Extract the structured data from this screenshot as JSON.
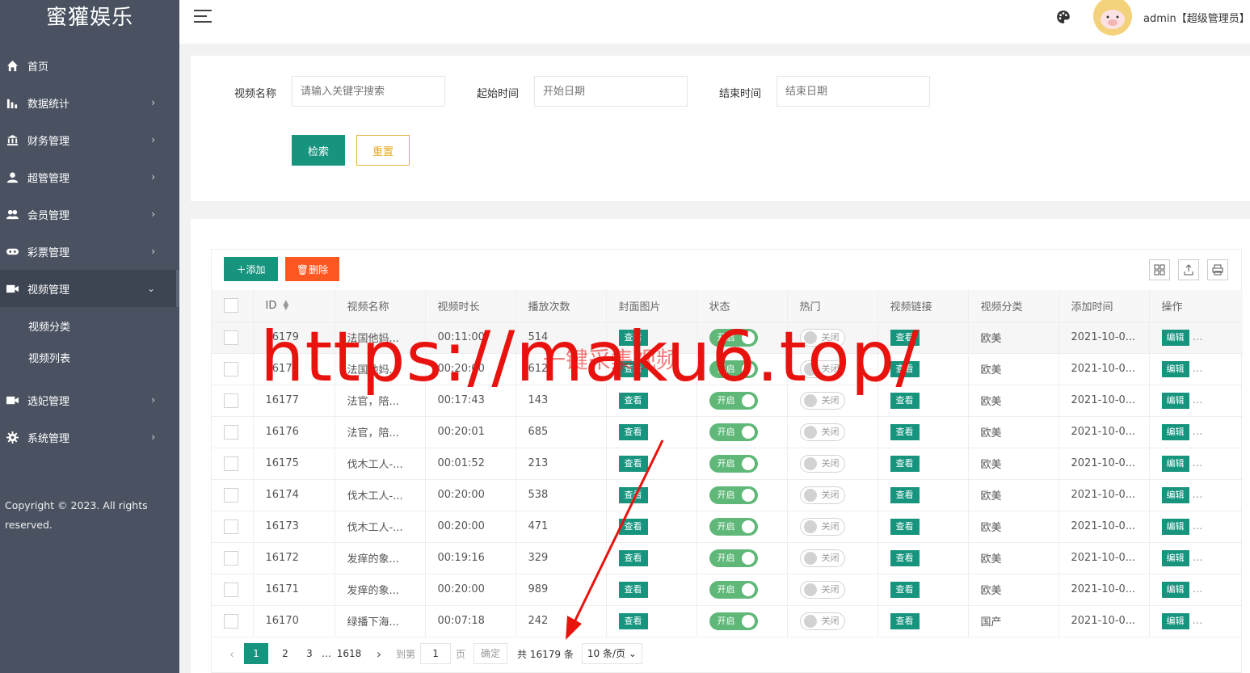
{
  "app": {
    "logo": "蜜獾娱乐"
  },
  "sidebar": {
    "items": [
      {
        "label": "首页",
        "icon": "home-icon",
        "arrow": ""
      },
      {
        "label": "数据统计",
        "icon": "bar-chart-icon",
        "arrow": "›"
      },
      {
        "label": "财务管理",
        "icon": "bank-icon",
        "arrow": "›"
      },
      {
        "label": "超管管理",
        "icon": "user-icon",
        "arrow": "›"
      },
      {
        "label": "会员管理",
        "icon": "users-icon",
        "arrow": "›"
      },
      {
        "label": "彩票管理",
        "icon": "gamepad-icon",
        "arrow": "›"
      },
      {
        "label": "视频管理",
        "icon": "video-icon",
        "arrow": "⌄"
      }
    ],
    "sub_items": [
      {
        "label": "视频分类"
      },
      {
        "label": "视频列表"
      }
    ],
    "items_after": [
      {
        "label": "选妃管理",
        "icon": "video-icon",
        "arrow": "›"
      },
      {
        "label": "系统管理",
        "icon": "gear-icon",
        "arrow": "›"
      }
    ],
    "copyright": "Copyright © 2023. All rights reserved."
  },
  "header": {
    "user": "admin【超级管理员】"
  },
  "search": {
    "name_label": "视频名称",
    "name_placeholder": "请输入关键字搜索",
    "start_label": "起始时间",
    "start_placeholder": "开始日期",
    "end_label": "结束时间",
    "end_placeholder": "结束日期",
    "search_btn": "检索",
    "reset_btn": "重置"
  },
  "toolbar": {
    "add_label": "添加",
    "delete_label": "删除"
  },
  "table": {
    "columns": [
      "ID",
      "视频名称",
      "视频时长",
      "播放次数",
      "封面图片",
      "状态",
      "热门",
      "视频链接",
      "视频分类",
      "添加时间",
      "操作"
    ],
    "view_label": "查看",
    "on_label": "开启",
    "off_label": "关闭",
    "edit_label": "编辑",
    "more_label": "…",
    "rows": [
      {
        "id": "16179",
        "name": "法国他妈...",
        "duration": "00:11:00",
        "plays": "514",
        "category": "欧美",
        "added": "2021-10-0..."
      },
      {
        "id": "16178",
        "name": "法国他妈...",
        "duration": "00:20:00",
        "plays": "612",
        "category": "欧美",
        "added": "2021-10-0..."
      },
      {
        "id": "16177",
        "name": "法官，陪...",
        "duration": "00:17:43",
        "plays": "143",
        "category": "欧美",
        "added": "2021-10-0..."
      },
      {
        "id": "16176",
        "name": "法官，陪...",
        "duration": "00:20:01",
        "plays": "685",
        "category": "欧美",
        "added": "2021-10-0..."
      },
      {
        "id": "16175",
        "name": "伐木工人-...",
        "duration": "00:01:52",
        "plays": "213",
        "category": "欧美",
        "added": "2021-10-0..."
      },
      {
        "id": "16174",
        "name": "伐木工人-...",
        "duration": "00:20:00",
        "plays": "538",
        "category": "欧美",
        "added": "2021-10-0..."
      },
      {
        "id": "16173",
        "name": "伐木工人-...",
        "duration": "00:20:00",
        "plays": "471",
        "category": "欧美",
        "added": "2021-10-0..."
      },
      {
        "id": "16172",
        "name": "发痒的象...",
        "duration": "00:19:16",
        "plays": "329",
        "category": "欧美",
        "added": "2021-10-0..."
      },
      {
        "id": "16171",
        "name": "发痒的象...",
        "duration": "00:20:00",
        "plays": "989",
        "category": "欧美",
        "added": "2021-10-0..."
      },
      {
        "id": "16170",
        "name": "绿播下海...",
        "duration": "00:07:18",
        "plays": "242",
        "category": "国产",
        "added": "2021-10-0..."
      }
    ]
  },
  "pagination": {
    "pages": [
      "1",
      "2",
      "3"
    ],
    "ellipsis": "…",
    "last_page": "1618",
    "goto_label": "到第",
    "goto_value": "1",
    "page_unit": "页",
    "confirm": "确定",
    "total": "共 16179 条",
    "page_size": "10 条/页"
  },
  "overlay": {
    "url": "https://maku6.top/",
    "cn": "一键采集视频"
  },
  "colors": {
    "primary": "#16947e",
    "danger": "#ff5722",
    "switch_on": "#5fb878",
    "sidebar": "#4a5261",
    "watermark": "#e8130f"
  }
}
